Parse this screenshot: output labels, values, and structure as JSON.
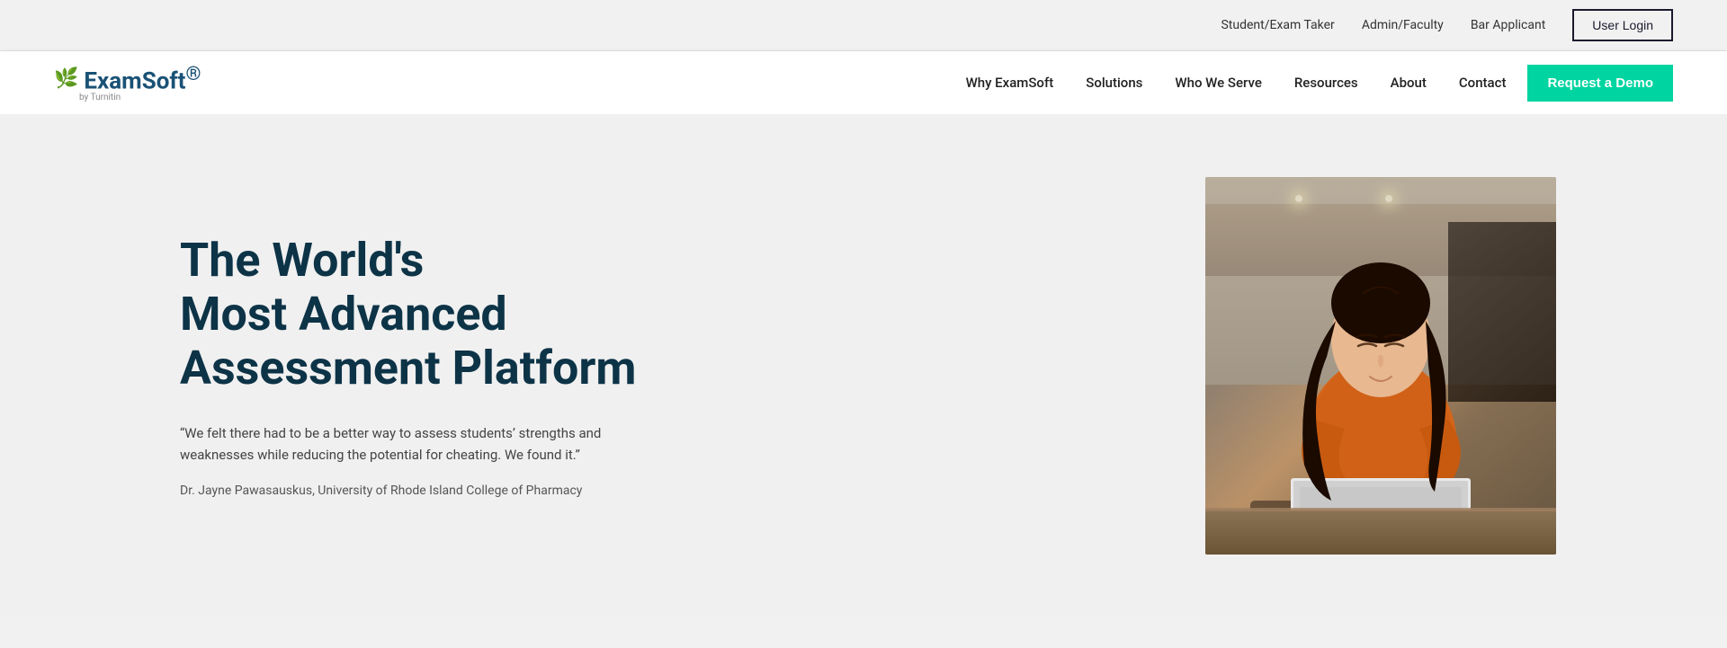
{
  "topbar": {
    "links": [
      {
        "id": "student-exam-taker",
        "label": "Student/Exam Taker"
      },
      {
        "id": "admin-faculty",
        "label": "Admin/Faculty"
      },
      {
        "id": "bar-applicant",
        "label": "Bar Applicant"
      }
    ],
    "user_login_label": "User Login"
  },
  "mainnav": {
    "logo": {
      "icon": "🌿",
      "brand": "ExamSoft",
      "trademark": "®",
      "subtitle": "by Turnitin"
    },
    "links": [
      {
        "id": "why-examsoft",
        "label": "Why ExamSoft"
      },
      {
        "id": "solutions",
        "label": "Solutions"
      },
      {
        "id": "who-we-serve",
        "label": "Who We Serve"
      },
      {
        "id": "resources",
        "label": "Resources"
      },
      {
        "id": "about",
        "label": "About"
      },
      {
        "id": "contact",
        "label": "Contact"
      }
    ],
    "cta_label": "Request a Demo"
  },
  "hero": {
    "title": "The World's\nMost Advanced\nAssessment Platform",
    "quote": "“We felt there had to be a better way to assess students’ strengths and weaknesses while reducing the potential for cheating. We found it.”",
    "attribution": "Dr. Jayne Pawasauskus, University of Rhode Island College of Pharmacy"
  }
}
